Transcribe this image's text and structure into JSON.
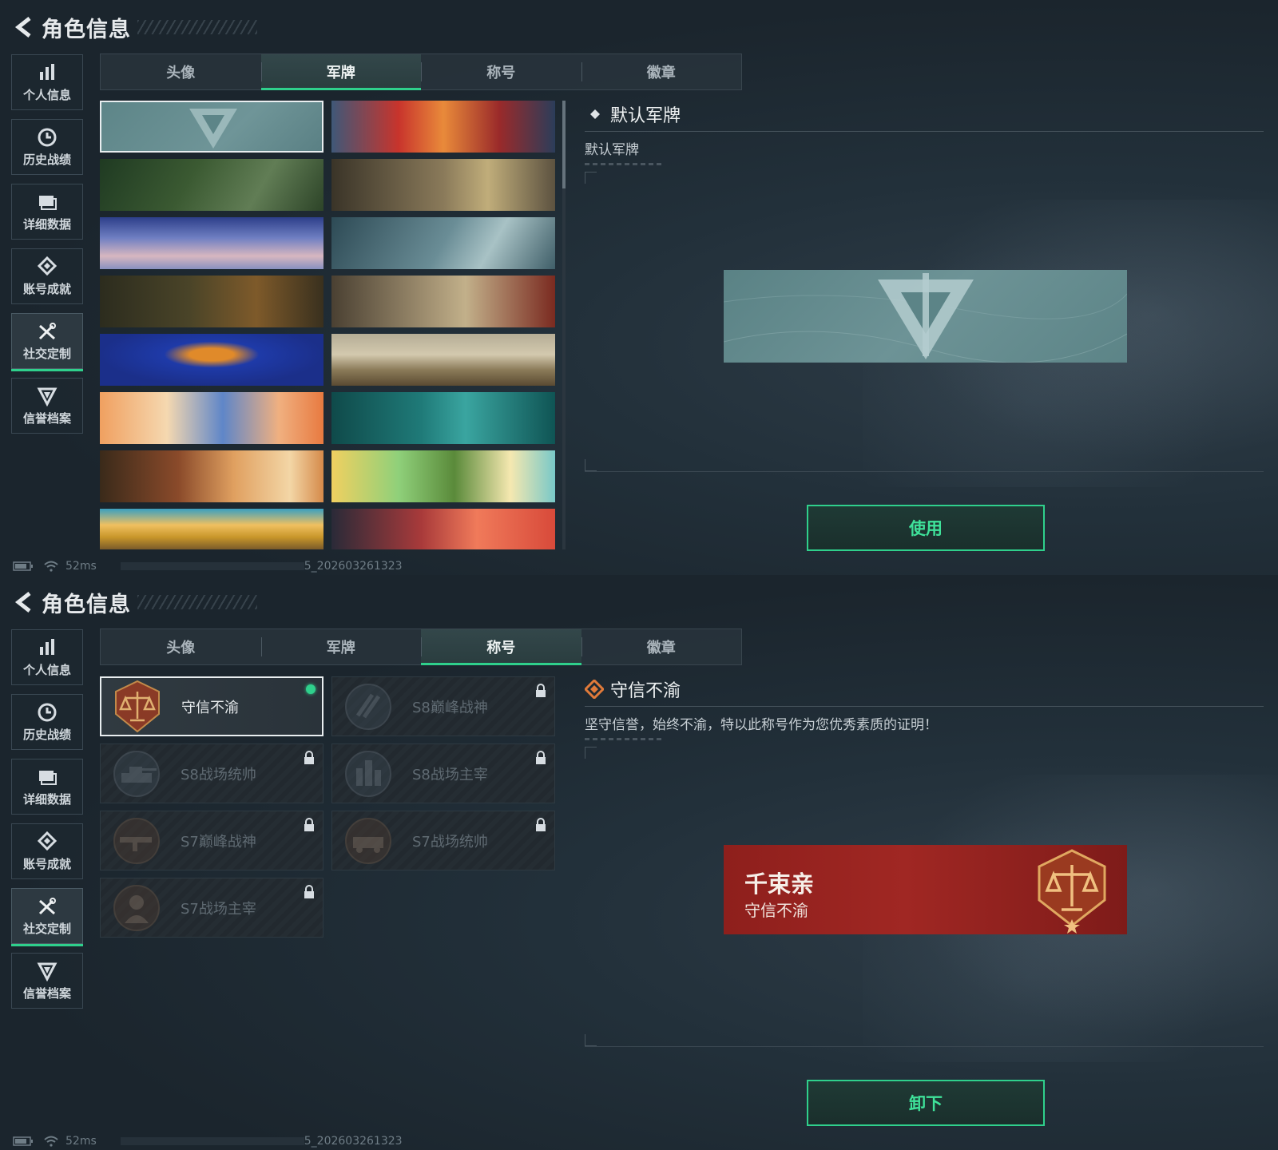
{
  "app": {
    "title": "角色信息"
  },
  "sidebar": {
    "items": [
      {
        "label": "个人信息",
        "icon": "bar-chart-icon"
      },
      {
        "label": "历史战绩",
        "icon": "clock-icon"
      },
      {
        "label": "详细数据",
        "icon": "folder-icon"
      },
      {
        "label": "账号成就",
        "icon": "diamond-badge-icon"
      },
      {
        "label": "社交定制",
        "icon": "tools-icon",
        "active": true
      },
      {
        "label": "信誉档案",
        "icon": "shield-emblem-icon"
      }
    ]
  },
  "tabs": [
    "头像",
    "军牌",
    "称号",
    "徽章"
  ],
  "screen1": {
    "active_tab": "军牌",
    "detail": {
      "title": "默认军牌",
      "subtitle": "默认军牌"
    },
    "action_button": "使用",
    "cards": [
      {
        "name": "default-logo",
        "selected": true
      },
      {
        "name": "explosion-weapon"
      },
      {
        "name": "camo-gear"
      },
      {
        "name": "helicopter-soldier"
      },
      {
        "name": "parachute-sky"
      },
      {
        "name": "storm-aircraft"
      },
      {
        "name": "rifle-field"
      },
      {
        "name": "bomber-dust"
      },
      {
        "name": "blue-helmet"
      },
      {
        "name": "desert-sniper"
      },
      {
        "name": "orange-art"
      },
      {
        "name": "teal-gym"
      },
      {
        "name": "sunset-rifleman"
      },
      {
        "name": "music-headphones"
      },
      {
        "name": "desert-vehicle"
      },
      {
        "name": "city-sunset-girl"
      }
    ]
  },
  "screen2": {
    "active_tab": "称号",
    "detail": {
      "title": "守信不渝",
      "subtitle": "坚守信誉，始终不渝，特以此称号作为您优秀素质的证明！"
    },
    "action_button": "卸下",
    "nameplate": {
      "player_name": "千束亲",
      "title": "守信不渝"
    },
    "titles": [
      {
        "label": "守信不渝",
        "locked": false,
        "equipped": true
      },
      {
        "label": "S8巅峰战神",
        "locked": true
      },
      {
        "label": "S8战场统帅",
        "locked": true
      },
      {
        "label": "S8战场主宰",
        "locked": true
      },
      {
        "label": "S7巅峰战神",
        "locked": true
      },
      {
        "label": "S7战场统帅",
        "locked": true
      },
      {
        "label": "S7战场主宰",
        "locked": true
      }
    ]
  },
  "status": {
    "ping": "52ms",
    "version": "5_202603261323"
  },
  "colors": {
    "accent": "#2fd08c",
    "bg": "#1b242c",
    "nameplate_red": "#a02723"
  }
}
